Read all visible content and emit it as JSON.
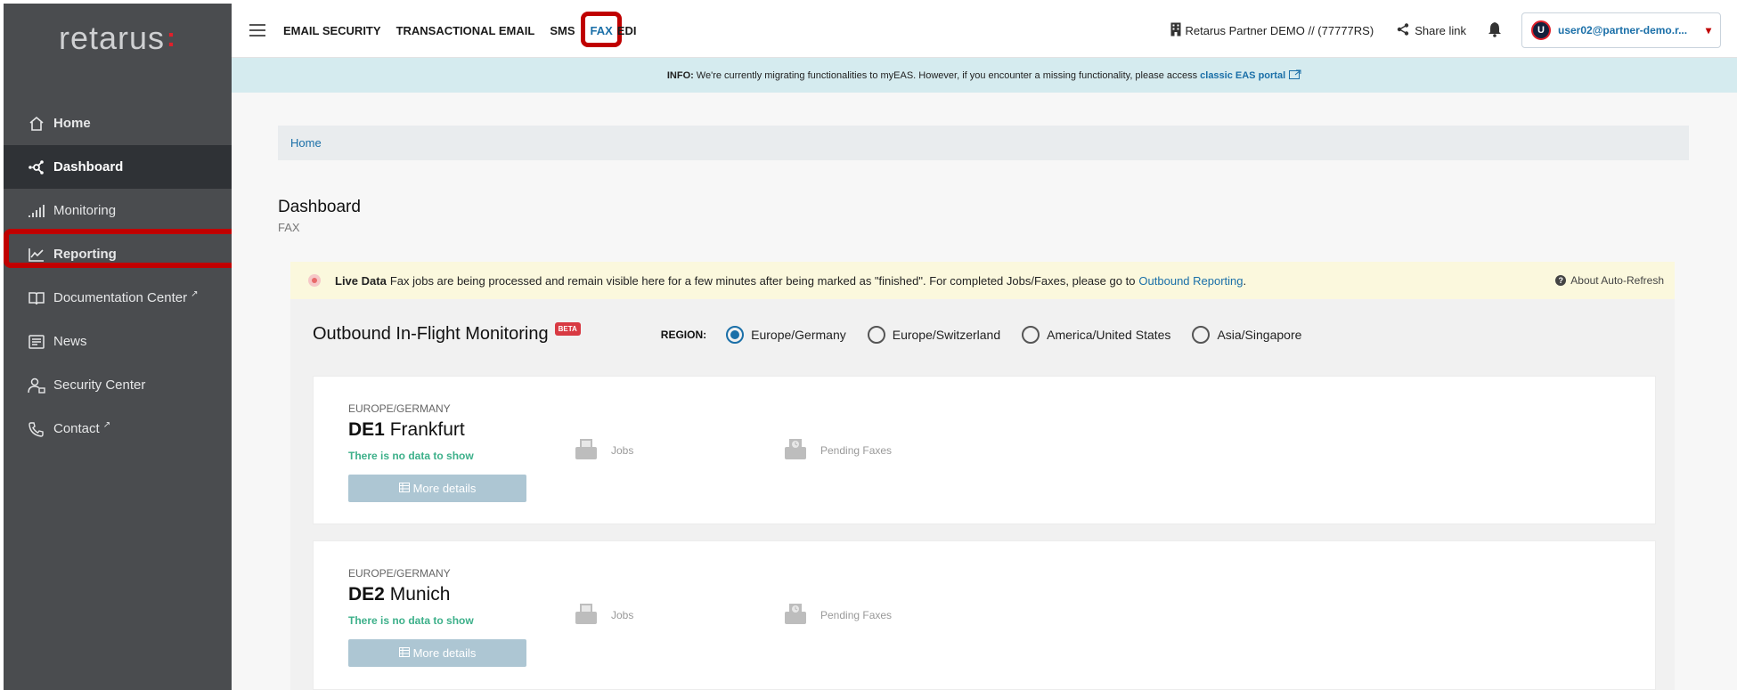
{
  "sidebar": {
    "logo": "retarus",
    "logo_mark": ":",
    "items": [
      {
        "label": "Home",
        "icon": "home-icon"
      },
      {
        "label": "Dashboard",
        "icon": "dashboard-icon"
      },
      {
        "label": "Monitoring",
        "icon": "signal-icon"
      },
      {
        "label": "Reporting",
        "icon": "chart-icon"
      },
      {
        "label": "Documentation Center",
        "icon": "book-icon",
        "external": true
      },
      {
        "label": "News",
        "icon": "news-icon"
      },
      {
        "label": "Security Center",
        "icon": "user-lock-icon"
      },
      {
        "label": "Contact",
        "icon": "phone-icon",
        "external": true
      }
    ],
    "active": "Dashboard"
  },
  "topbar": {
    "tabs": [
      "EMAIL SECURITY",
      "TRANSACTIONAL EMAIL",
      "SMS",
      "FAX",
      "EDI"
    ],
    "active_tab": "FAX",
    "tenant": "Retarus Partner DEMO // (77777RS)",
    "share": "Share link",
    "user": "user02@partner-demo.r...",
    "avatar": "U"
  },
  "info_banner": {
    "label": "INFO:",
    "text": "We're currently migrating functionalities to myEAS. However, if you encounter a missing functionality, please access",
    "link": "classic EAS portal"
  },
  "breadcrumb": "Home",
  "page": {
    "title": "Dashboard",
    "subtitle": "FAX"
  },
  "live": {
    "label": "Live Data",
    "text": "Fax jobs are being processed and remain visible here for a few minutes after being marked as \"finished\". For completed Jobs/Faxes, please go to",
    "link": "Outbound Reporting",
    "end": ".",
    "about": "About Auto-Refresh"
  },
  "monitoring": {
    "title": "Outbound In-Flight Monitoring",
    "badge": "BETA",
    "region_label": "REGION:",
    "regions": [
      "Europe/Germany",
      "Europe/Switzerland",
      "America/United States",
      "Asia/Singapore"
    ],
    "selected_region": "Europe/Germany"
  },
  "cards": [
    {
      "region": "EUROPE/GERMANY",
      "code": "DE1",
      "city": "Frankfurt",
      "status": "There is no data to show",
      "button": "More details",
      "jobs_label": "Jobs",
      "pending_label": "Pending Faxes"
    },
    {
      "region": "EUROPE/GERMANY",
      "code": "DE2",
      "city": "Munich",
      "status": "There is no data to show",
      "button": "More details",
      "jobs_label": "Jobs",
      "pending_label": "Pending Faxes"
    }
  ],
  "colors": {
    "sidebar_bg": "#4a4c4f",
    "sidebar_active": "#2f3236",
    "link": "#1a6fa8",
    "highlight": "#c00000",
    "success": "#3db08a"
  }
}
